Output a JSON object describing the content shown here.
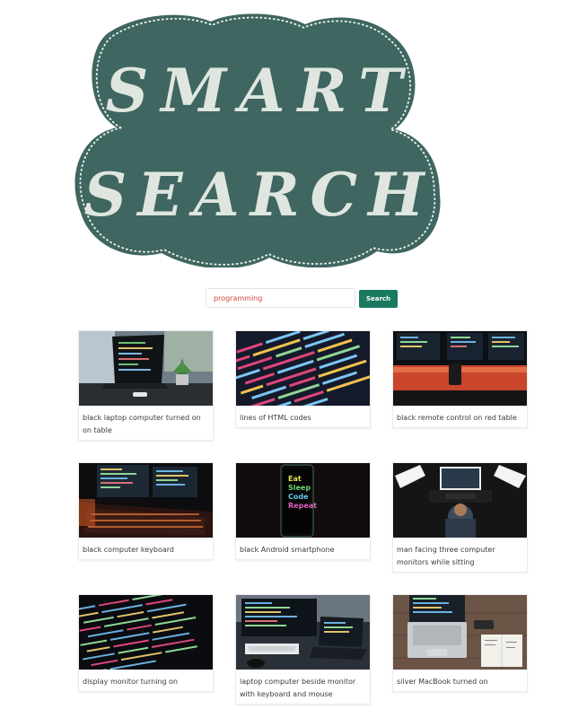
{
  "logo": {
    "line1": "SMART",
    "line2": "SEARCH",
    "bg_color": "#3f6660"
  },
  "search": {
    "value": "programming",
    "button_label": "Search",
    "button_color": "#1a7a5f"
  },
  "results": [
    {
      "caption": "black laptop computer turned on on table"
    },
    {
      "caption": "lines of HTML codes"
    },
    {
      "caption": "black remote control on red table"
    },
    {
      "caption": "black computer keyboard"
    },
    {
      "caption": "black Android smartphone",
      "screen_text": [
        "Eat",
        "Sleep",
        "Code",
        "Repeat"
      ]
    },
    {
      "caption": "man facing three computer monitors while sitting"
    },
    {
      "caption": "display monitor turning on"
    },
    {
      "caption": "laptop computer beside monitor with keyboard and mouse"
    },
    {
      "caption": "silver MacBook turned on"
    }
  ]
}
